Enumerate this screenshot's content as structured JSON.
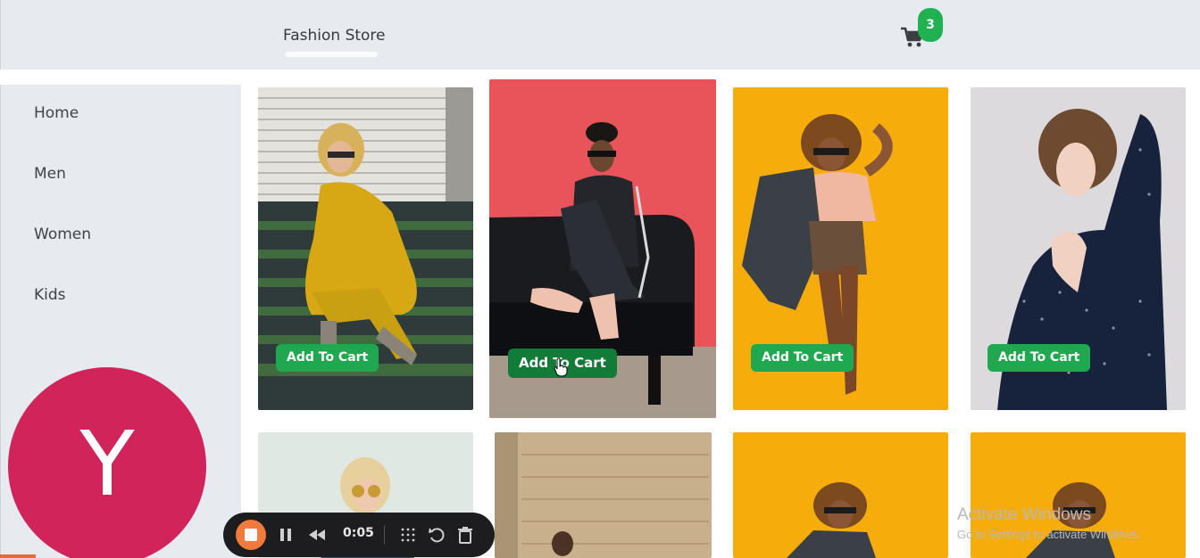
{
  "header": {
    "brand": "Fashion Store",
    "cart_icon": "shopping-cart-icon",
    "cart_count": "3"
  },
  "sidebar": {
    "items": [
      {
        "label": "Home"
      },
      {
        "label": "Men"
      },
      {
        "label": "Women"
      },
      {
        "label": "Kids"
      }
    ]
  },
  "products": {
    "button_label": "Add To Cart",
    "colors": {
      "button": "#1fa84f",
      "button_pressed": "#137b38",
      "badge": "#20b151",
      "background_red": "#e8545a",
      "background_yellow": "#f6ad0c"
    }
  },
  "recorder": {
    "logo_letter": "Y",
    "logo_color": "#d1245a",
    "time": "0:05",
    "icons": [
      "stop-icon",
      "pause-icon",
      "rewind-icon",
      "grid-icon",
      "undo-icon",
      "trash-icon"
    ]
  },
  "watermark": {
    "line1": "Activate Windows",
    "line2": "Go to Settings to activate Windows."
  }
}
